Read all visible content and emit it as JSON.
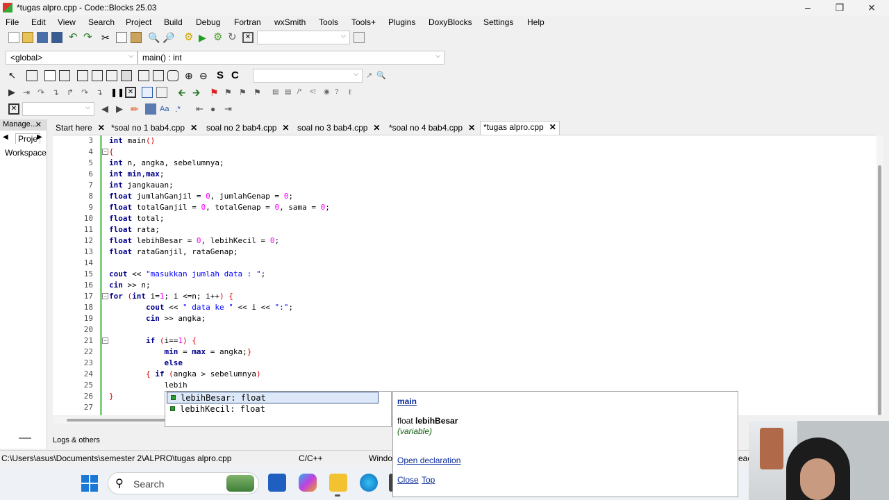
{
  "window": {
    "title": "*tugas alpro.cpp - Code::Blocks 25.03"
  },
  "menu": [
    "File",
    "Edit",
    "View",
    "Search",
    "Project",
    "Build",
    "Debug",
    "Fortran",
    "wxSmith",
    "Tools",
    "Tools+",
    "Plugins",
    "DoxyBlocks",
    "Settings",
    "Help"
  ],
  "scope": {
    "global": "<global>",
    "function": "main() : int"
  },
  "left_panel": {
    "header": "Manage...",
    "tab": "Proje",
    "item": "Workspace"
  },
  "tabs": [
    {
      "label": "Start here",
      "active": false
    },
    {
      "label": "*soal no 1 bab4.cpp",
      "active": false
    },
    {
      "label": "soal no 2 bab4.cpp",
      "active": false
    },
    {
      "label": "soal no 3 bab4.cpp",
      "active": false
    },
    {
      "label": "*soal no 4 bab4.cpp",
      "active": false
    },
    {
      "label": "*tugas alpro.cpp",
      "active": true
    }
  ],
  "code": [
    {
      "n": "3",
      "text": "int main()"
    },
    {
      "n": "4",
      "text": "{"
    },
    {
      "n": "5",
      "text": "int n, angka, sebelumnya;"
    },
    {
      "n": "6",
      "text": "int min,max;"
    },
    {
      "n": "7",
      "text": "int jangkauan;"
    },
    {
      "n": "8",
      "text": "float jumlahGanjil = 0, jumlahGenap = 0;"
    },
    {
      "n": "9",
      "text": "float totalGanjil = 0, totalGenap = 0, sama = 0;"
    },
    {
      "n": "10",
      "text": "float total;"
    },
    {
      "n": "11",
      "text": "float rata;"
    },
    {
      "n": "12",
      "text": "float lebihBesar = 0, lebihKecil = 0;"
    },
    {
      "n": "13",
      "text": "float rataGanjil, rataGenap;"
    },
    {
      "n": "14",
      "text": ""
    },
    {
      "n": "15",
      "text": "cout << \"masukkan jumlah data : \";"
    },
    {
      "n": "16",
      "text": "cin >> n;"
    },
    {
      "n": "17",
      "text": "for (int i=1; i <=n; i++) {"
    },
    {
      "n": "18",
      "text": "        cout << \" data ke \" << i << \":\";"
    },
    {
      "n": "19",
      "text": "        cin >> angka;"
    },
    {
      "n": "20",
      "text": ""
    },
    {
      "n": "21",
      "text": "        if (i==1) {"
    },
    {
      "n": "22",
      "text": "            min = max = angka;}"
    },
    {
      "n": "23",
      "text": "            else"
    },
    {
      "n": "24",
      "text": "        { if (angka > sebelumnya)"
    },
    {
      "n": "25",
      "text": "            lebih"
    },
    {
      "n": "26",
      "text": "}"
    },
    {
      "n": "27",
      "text": ""
    }
  ],
  "autocomplete": {
    "items": [
      "lebihBesar: float",
      "lebihKecil: float"
    ],
    "selected_index": 0,
    "doc_scope": "main",
    "doc_type": "float",
    "doc_name": "lebihBesar",
    "doc_kind": "(variable)",
    "open_decl": "Open declaration",
    "close": "Close",
    "top": "Top"
  },
  "logs_label": "Logs & others",
  "status": {
    "path": "C:\\Users\\asus\\Documents\\semester 2\\ALPRO\\tugas alpro.cpp",
    "lang": "C/C++",
    "eol": "Windo",
    "right": "eac"
  },
  "taskbar": {
    "search_placeholder": "Search"
  }
}
